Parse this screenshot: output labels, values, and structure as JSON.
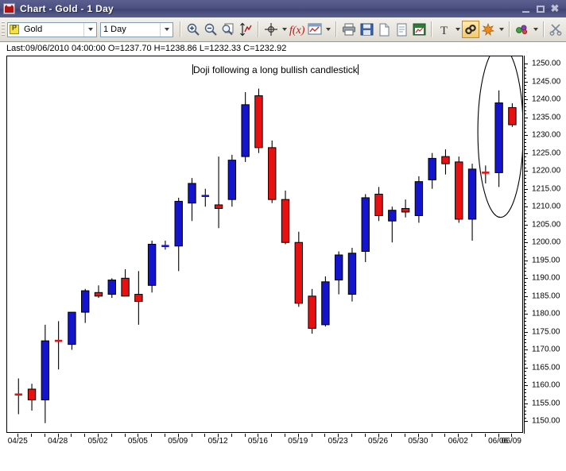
{
  "window": {
    "title": "Chart - Gold - 1 Day",
    "icon": "bull-icon",
    "minimize_label": "",
    "maximize_label": "",
    "close_label": "✖"
  },
  "toolbar": {
    "symbol": {
      "value": "Gold",
      "icon": "symbol-icon"
    },
    "period": {
      "value": "1 Day"
    },
    "buttons": [
      {
        "name": "zoom-in-icon",
        "label": ""
      },
      {
        "name": "zoom-out-icon",
        "label": ""
      },
      {
        "name": "zoom-region-icon",
        "label": ""
      },
      {
        "name": "scale-icon",
        "label": ""
      },
      {
        "name": "crosshair-icon",
        "label": ""
      },
      {
        "name": "function-icon",
        "label": "f(x)"
      },
      {
        "name": "window-style-icon",
        "label": ""
      },
      {
        "name": "print-icon",
        "label": ""
      },
      {
        "name": "save-icon",
        "label": ""
      },
      {
        "name": "new-document-icon",
        "label": ""
      },
      {
        "name": "page-icon",
        "label": ""
      },
      {
        "name": "save-chart-icon",
        "label": ""
      },
      {
        "name": "text-tool-icon",
        "label": "T"
      },
      {
        "name": "link-tool-icon",
        "label": ""
      },
      {
        "name": "marker-tool-icon",
        "label": ""
      },
      {
        "name": "shapes-tool-icon",
        "label": ""
      },
      {
        "name": "scissors-tool-icon",
        "label": ""
      }
    ]
  },
  "status": {
    "text": "Last:09/06/2010 04:00:00 O=1237.70 H=1238.86 L=1232.33 C=1232.92",
    "last_date": "09/06/2010",
    "last_time": "04:00:00",
    "open": "1237.70",
    "high": "1238.86",
    "low": "1232.33",
    "close": "1232.92"
  },
  "annotation": {
    "text": "Doji following a long bullish candlestick",
    "shape": "ellipse-highlight"
  },
  "chart_data": {
    "type": "candlestick",
    "title": "Chart - Gold - 1 Day",
    "xlabel": "",
    "ylabel": "",
    "ylim": [
      1147,
      1252
    ],
    "ytick_step": 5,
    "grid": false,
    "legend": "none",
    "up_color": "#1414cc",
    "down_color": "#e81010",
    "yticks": [
      "1250.00",
      "1245.00",
      "1240.00",
      "1235.00",
      "1230.00",
      "1225.00",
      "1220.00",
      "1215.00",
      "1210.00",
      "1205.00",
      "1200.00",
      "1195.00",
      "1190.00",
      "1185.00",
      "1180.00",
      "1175.00",
      "1170.00",
      "1165.00",
      "1160.00",
      "1155.00",
      "1150.00"
    ],
    "xticks": [
      "04/25",
      "04/28",
      "05/02",
      "05/05",
      "05/09",
      "05/12",
      "05/16",
      "05/19",
      "05/23",
      "05/26",
      "05/30",
      "06/02",
      "06/06",
      "06/09"
    ],
    "candles": [
      {
        "o": 1157.5,
        "h": 1162.0,
        "l": 1152.0,
        "c": 1157.2
      },
      {
        "o": 1159.0,
        "h": 1160.5,
        "l": 1153.0,
        "c": 1156.0
      },
      {
        "o": 1156.0,
        "h": 1177.0,
        "l": 1149.5,
        "c": 1172.5
      },
      {
        "o": 1172.5,
        "h": 1178.0,
        "l": 1164.5,
        "c": 1172.0
      },
      {
        "o": 1171.5,
        "h": 1180.0,
        "l": 1170.0,
        "c": 1180.5
      },
      {
        "o": 1180.5,
        "h": 1187.0,
        "l": 1177.5,
        "c": 1186.5
      },
      {
        "o": 1186.0,
        "h": 1188.0,
        "l": 1184.5,
        "c": 1185.0
      },
      {
        "o": 1185.5,
        "h": 1190.0,
        "l": 1184.5,
        "c": 1189.5
      },
      {
        "o": 1190.0,
        "h": 1192.5,
        "l": 1185.0,
        "c": 1185.0
      },
      {
        "o": 1185.5,
        "h": 1192.0,
        "l": 1177.0,
        "c": 1183.5
      },
      {
        "o": 1188.0,
        "h": 1200.5,
        "l": 1186.0,
        "c": 1199.5
      },
      {
        "o": 1199.0,
        "h": 1200.5,
        "l": 1198.0,
        "c": 1199.0
      },
      {
        "o": 1199.0,
        "h": 1212.5,
        "l": 1192.0,
        "c": 1211.5
      },
      {
        "o": 1211.0,
        "h": 1218.0,
        "l": 1206.0,
        "c": 1216.5
      },
      {
        "o": 1212.5,
        "h": 1215.0,
        "l": 1210.0,
        "c": 1213.0
      },
      {
        "o": 1210.5,
        "h": 1224.0,
        "l": 1204.0,
        "c": 1209.5
      },
      {
        "o": 1212.0,
        "h": 1224.5,
        "l": 1210.0,
        "c": 1223.0
      },
      {
        "o": 1224.0,
        "h": 1242.0,
        "l": 1222.5,
        "c": 1238.5
      },
      {
        "o": 1241.0,
        "h": 1243.0,
        "l": 1225.0,
        "c": 1226.5
      },
      {
        "o": 1226.5,
        "h": 1228.5,
        "l": 1211.0,
        "c": 1212.0
      },
      {
        "o": 1212.0,
        "h": 1214.5,
        "l": 1199.5,
        "c": 1200.0
      },
      {
        "o": 1200.0,
        "h": 1203.0,
        "l": 1182.0,
        "c": 1183.0
      },
      {
        "o": 1185.0,
        "h": 1187.0,
        "l": 1174.5,
        "c": 1176.0
      },
      {
        "o": 1177.0,
        "h": 1190.5,
        "l": 1176.5,
        "c": 1189.0
      },
      {
        "o": 1189.5,
        "h": 1197.5,
        "l": 1185.5,
        "c": 1196.5
      },
      {
        "o": 1185.5,
        "h": 1198.5,
        "l": 1183.5,
        "c": 1197.0
      },
      {
        "o": 1197.5,
        "h": 1213.5,
        "l": 1194.5,
        "c": 1212.5
      },
      {
        "o": 1213.5,
        "h": 1215.5,
        "l": 1206.0,
        "c": 1207.5
      },
      {
        "o": 1206.0,
        "h": 1210.0,
        "l": 1200.0,
        "c": 1209.0
      },
      {
        "o": 1209.5,
        "h": 1212.0,
        "l": 1207.0,
        "c": 1208.5
      },
      {
        "o": 1207.5,
        "h": 1218.5,
        "l": 1205.5,
        "c": 1217.0
      },
      {
        "o": 1217.5,
        "h": 1225.0,
        "l": 1215.0,
        "c": 1223.5
      },
      {
        "o": 1224.0,
        "h": 1226.0,
        "l": 1219.0,
        "c": 1222.0
      },
      {
        "o": 1222.5,
        "h": 1224.0,
        "l": 1205.5,
        "c": 1206.5
      },
      {
        "o": 1206.5,
        "h": 1222.0,
        "l": 1200.5,
        "c": 1220.5
      },
      {
        "o": 1219.5,
        "h": 1221.5,
        "l": 1216.5,
        "c": 1219.0
      },
      {
        "o": 1219.5,
        "h": 1242.5,
        "l": 1215.5,
        "c": 1239.0
      },
      {
        "o": 1237.7,
        "h": 1238.9,
        "l": 1232.3,
        "c": 1232.9
      }
    ]
  }
}
